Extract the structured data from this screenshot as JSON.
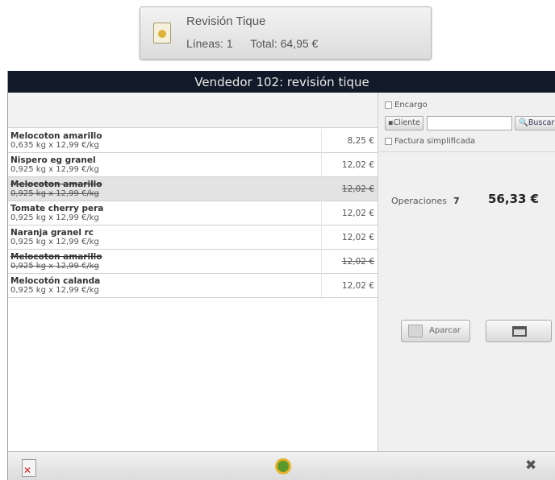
{
  "summary": {
    "title": "Revisión Tique",
    "lines_label": "Líneas: 1",
    "total_label": "Total:  64,95 €"
  },
  "window": {
    "title": "Vendedor 102: revisión tique"
  },
  "ticket": {
    "items": [
      {
        "name": "Melocoton amarillo",
        "qty": "0,635 kg x 12,99 €/kg",
        "amount": "8,25 €",
        "deleted": false,
        "selected": false
      },
      {
        "name": "Nispero eg granel",
        "qty": "0,925 kg x 12,99 €/kg",
        "amount": "12,02 €",
        "deleted": false,
        "selected": false
      },
      {
        "name": "Melocoton amarillo",
        "qty": "0,925 kg x 12,99 €/kg",
        "amount": "12,02 €",
        "deleted": true,
        "selected": true
      },
      {
        "name": "Tomate cherry pera",
        "qty": "0,925 kg x 12,99 €/kg",
        "amount": "12,02 €",
        "deleted": false,
        "selected": false
      },
      {
        "name": "Naranja granel rc",
        "qty": "0,925 kg x 12,99 €/kg",
        "amount": "12,02 €",
        "deleted": false,
        "selected": false
      },
      {
        "name": "Melocoton amarillo",
        "qty": "0,925 kg x 12,99 €/kg",
        "amount": "12,02 €",
        "deleted": true,
        "selected": false
      },
      {
        "name": "Melocotón calanda",
        "qty": "0,925 kg x 12,99 €/kg",
        "amount": "12,02 €",
        "deleted": false,
        "selected": false
      }
    ]
  },
  "panel": {
    "encargo_label": "Encargo",
    "cliente_label": "Cliente",
    "cliente_value": "",
    "buscar_label": "Buscar",
    "factura_label": "Factura simplificada",
    "operaciones_label": "Operaciones",
    "operaciones_count": "7",
    "total": "56,33 €",
    "aparcar_label": "Aparcar"
  },
  "icons": {
    "summary": "ticket-icon",
    "search": "magnifier-icon",
    "aparcar": "park-icon",
    "print": "printer-icon",
    "delete": "delete-ticket-icon",
    "settings": "gear-icon",
    "close": "close-icon"
  }
}
